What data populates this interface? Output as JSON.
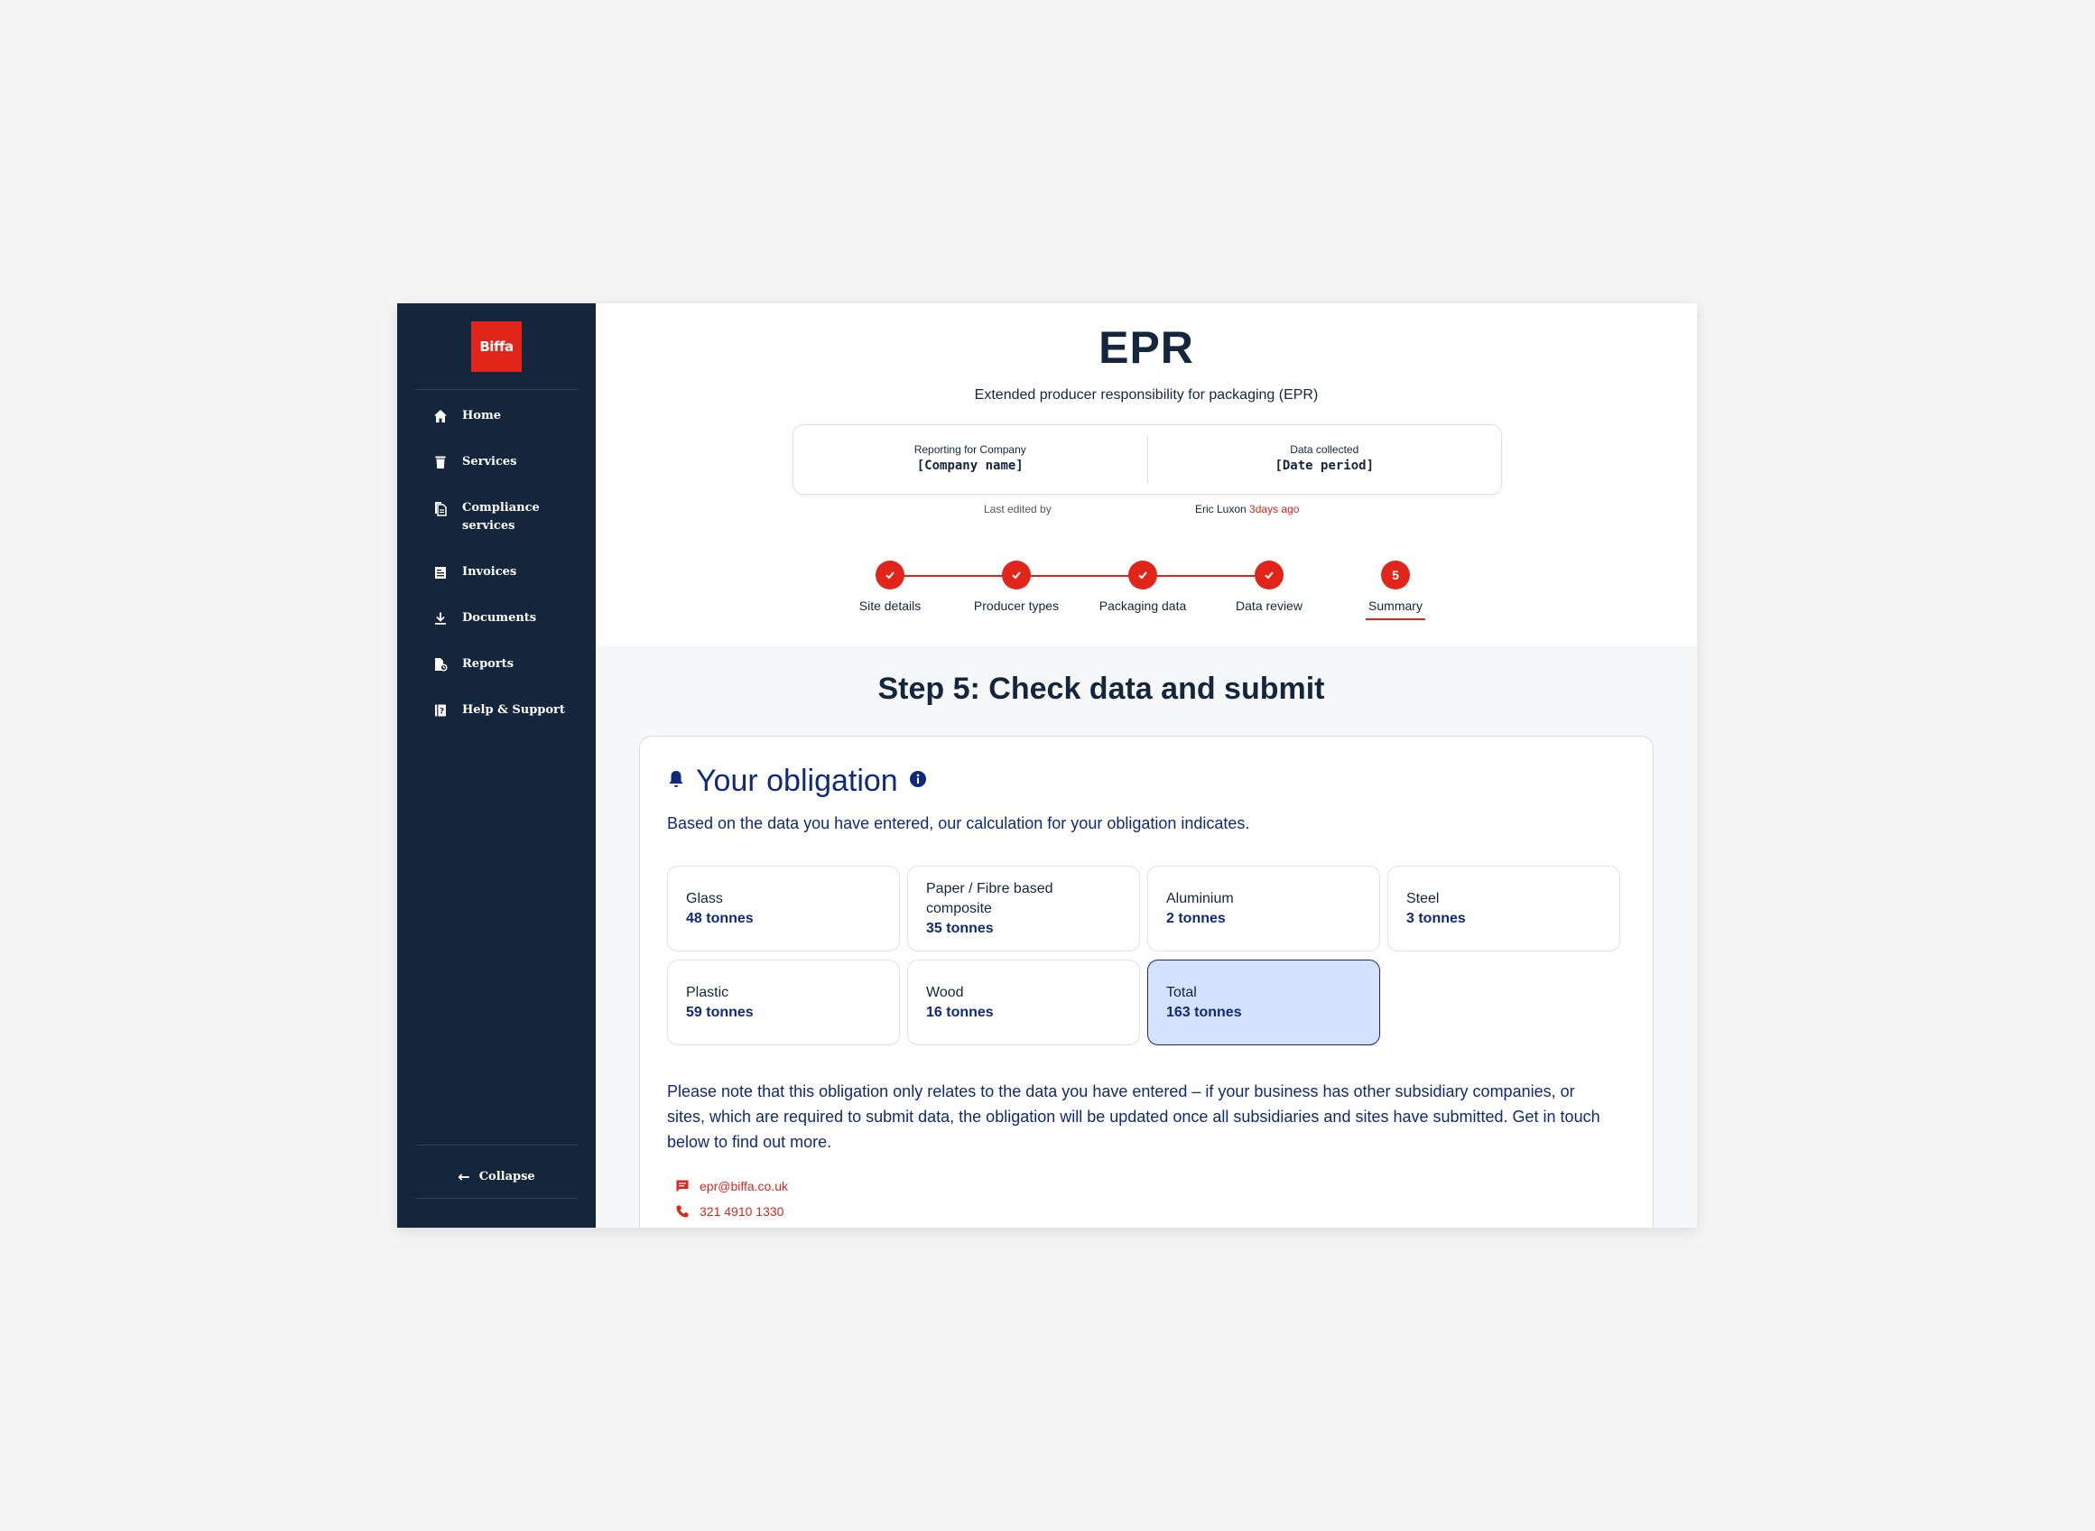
{
  "brand": {
    "logo_text": "Biffa",
    "accent": "#e1251b",
    "navy": "#13263b",
    "blue": "#0f2a78"
  },
  "sidebar": {
    "items": [
      {
        "label": "Home",
        "icon": "home-icon"
      },
      {
        "label": "Services",
        "icon": "bin-icon"
      },
      {
        "label": "Compliance services",
        "icon": "documents-icon"
      },
      {
        "label": "Invoices",
        "icon": "invoice-icon"
      },
      {
        "label": "Documents",
        "icon": "download-icon"
      },
      {
        "label": "Reports",
        "icon": "report-icon"
      },
      {
        "label": "Help & Support",
        "icon": "help-book-icon"
      }
    ],
    "collapse_label": "Collapse"
  },
  "header": {
    "title": "EPR",
    "subtitle": "Extended producer responsibility for packaging (EPR)",
    "company_label": "Reporting for Company",
    "company_value": "[Company name]",
    "data_label": "Data collected",
    "data_value": "[Date period]",
    "last_edited_label": "Last edited by",
    "last_edited_by": "Eric Luxon",
    "last_edited_ago": "3days ago"
  },
  "steps": [
    {
      "label": "Site details",
      "status": "complete"
    },
    {
      "label": "Producer types",
      "status": "complete"
    },
    {
      "label": "Packaging data",
      "status": "complete"
    },
    {
      "label": "Data review",
      "status": "complete"
    },
    {
      "label": "Summary",
      "status": "current",
      "number": "5"
    }
  ],
  "content": {
    "step_title": "Step 5: Check data and submit",
    "obligation_title": "Your obligation",
    "obligation_intro": "Based on the data you have entered, our calculation for your obligation indicates.",
    "materials": [
      {
        "name": "Glass",
        "value": "48 tonnes"
      },
      {
        "name": "Paper / Fibre based composite",
        "value": "35 tonnes"
      },
      {
        "name": "Aluminium",
        "value": "2 tonnes"
      },
      {
        "name": "Steel",
        "value": "3 tonnes"
      },
      {
        "name": "Plastic",
        "value": "59 tonnes"
      },
      {
        "name": "Wood",
        "value": "16 tonnes"
      },
      {
        "name": "Total",
        "value": "163 tonnes"
      }
    ],
    "note": "Please note that this obligation only relates to the data you have entered – if your business has other  subsidiary companies, or sites, which are required to submit data, the  obligation will be updated once all subsidiaries and sites have  submitted. Get in touch below to find out more.",
    "contact_email": "epr@biffa.co.uk",
    "contact_phone": "321 4910 1330"
  }
}
